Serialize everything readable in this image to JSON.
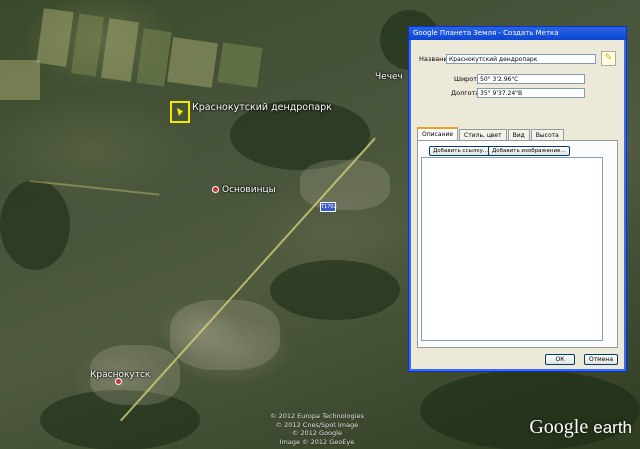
{
  "map": {
    "places": [
      {
        "label": "Краснокутский дендропарк",
        "marker": "pushpin-icon"
      },
      {
        "label": "Основинцы",
        "marker": "red-dot"
      },
      {
        "label": "Краснокутск",
        "marker": "red-dot"
      },
      {
        "label": "Чечеч",
        "marker": "red-dot"
      }
    ],
    "road_shield": "Т1702",
    "copyright": [
      "© 2012 Europa Technologies",
      "© 2012 Cnes/Spot Image",
      "© 2012 Google",
      "Image © 2012 GeoEye"
    ],
    "logo": {
      "google": "Google",
      "earth": "earth"
    }
  },
  "dialog": {
    "title": "Google Планета Земля - Создать Метка",
    "name_label": "Название:",
    "name_value": "Краснокутский дендропарк",
    "lat_label": "Широта:",
    "lat_value": "50° 3'2.96\"С",
    "lon_label": "Долгота:",
    "lon_value": "35° 9'37.24\"В",
    "tabs": [
      "Описание",
      "Стиль, цвет",
      "Вид",
      "Высота"
    ],
    "active_tab": "Описание",
    "add_link_label": "Добавить ссылку...",
    "add_image_label": "Добавить изображение...",
    "ok_label": "ОК",
    "cancel_label": "Отмена"
  },
  "colors": {
    "titlebar": "#0a46d6",
    "pin": "#f5e800"
  }
}
